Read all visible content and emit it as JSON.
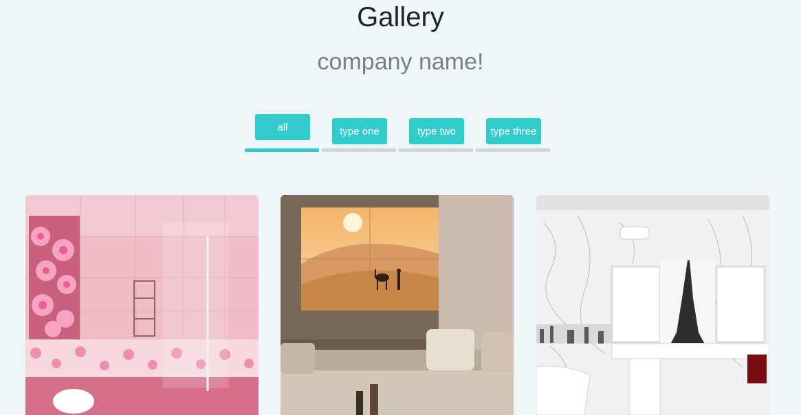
{
  "header": {
    "title": "Gallery",
    "subtitle": "company name!"
  },
  "filters": [
    {
      "label": "all",
      "active": true
    },
    {
      "label": "type one",
      "active": false
    },
    {
      "label": "type two",
      "active": false
    },
    {
      "label": "type three",
      "active": false
    }
  ],
  "colors": {
    "background": "#eff6fa",
    "accent": "#33cccc",
    "inactive_bar": "#d1d5d8"
  },
  "gallery": [
    {
      "subject": "pink bathroom with floral tiles and glass shower"
    },
    {
      "subject": "living room with desert camel wall art and sofa"
    },
    {
      "subject": "white marble bathroom with Eiffel Tower mural"
    }
  ]
}
